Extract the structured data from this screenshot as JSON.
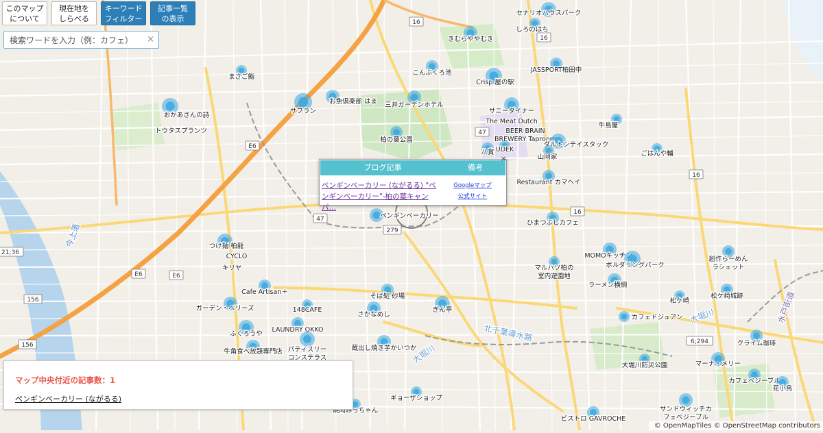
{
  "toolbar": {
    "about": "このマップ\nについて",
    "locate": "現在地を\nしらべる",
    "keyword": "キーワード\nフィルター",
    "list": "記事一覧\nの表示"
  },
  "search": {
    "placeholder": "検索ワードを入力（例：カフェ）",
    "value": "",
    "clear": "×"
  },
  "popup": {
    "col_article": "ブログ記事",
    "col_note": "備考",
    "article_title": "ペンギンベーカリー (ながるる) \"ペンギンベーカリー\"-柏の葉キャンパ…",
    "link_google": "Googleマップ",
    "link_official": "公式サイト",
    "close": "×"
  },
  "panel": {
    "count_text": "マップ中央付近の記事数：1",
    "item": "ペンギンベーカリー (ながるる)"
  },
  "attribution": "© OpenMapTiles © OpenStreetMap contributors",
  "places": [
    {
      "name": "セナリオハウスパーク"
    },
    {
      "name": "しろのはち"
    },
    {
      "name": "きむらややむき"
    },
    {
      "name": "まさご鮨"
    },
    {
      "name": "こんぶくろ池"
    },
    {
      "name": "Crisp 屋の駅"
    },
    {
      "name": "JASSPORT柏田中"
    },
    {
      "name": "お魚倶楽部 はま"
    },
    {
      "name": "三井ガーデンホテル"
    },
    {
      "name": "おかあさんの詩"
    },
    {
      "name": "サフラン"
    },
    {
      "name": "トウタスプランツ"
    },
    {
      "name": "サニーダイナー"
    },
    {
      "name": "The Meat Dutch"
    },
    {
      "name": "BEER BRAIN\nBREWERY Taproom"
    },
    {
      "name": "牛島屋"
    },
    {
      "name": "柏の葉公園"
    },
    {
      "name": "八賞"
    },
    {
      "name": "UDEK"
    },
    {
      "name": "ダルトンテイスタック"
    },
    {
      "name": "ごはんや輔"
    },
    {
      "name": "山岡家"
    },
    {
      "name": "Restaurant カマヘイ"
    },
    {
      "name": "ひまつぶしカフェ"
    },
    {
      "name": "ペンギンベーカリー"
    },
    {
      "name": "つけ麺 柏龍"
    },
    {
      "name": "CYCLO"
    },
    {
      "name": "キリヤ"
    },
    {
      "name": "MOMOキッチン"
    },
    {
      "name": "ボルダリングパーク"
    },
    {
      "name": "創作らーめん\nラシェット"
    },
    {
      "name": "マルハソ柏の\n室内遊園地"
    },
    {
      "name": "ラーメン横綱"
    },
    {
      "name": "Cafe Artisan＋"
    },
    {
      "name": "そば処 砂場"
    },
    {
      "name": "松ケ崎"
    },
    {
      "name": "松ケ崎城跡"
    },
    {
      "name": "ガーデン・ベリーズ"
    },
    {
      "name": "148CAFE"
    },
    {
      "name": "さかなめし"
    },
    {
      "name": "ぎん亭"
    },
    {
      "name": "カフェドジュアン"
    },
    {
      "name": "ふくろうや"
    },
    {
      "name": "LAUNDRY OKKO"
    },
    {
      "name": "パティスリー\nコンステラス"
    },
    {
      "name": "牛角食べ放題専門店"
    },
    {
      "name": "蔵出し焼き芋かいつか"
    },
    {
      "name": "クライム珈琲"
    },
    {
      "name": "大堀川防災公園"
    },
    {
      "name": "マーナ・メリー"
    },
    {
      "name": "カフェベジーブル"
    },
    {
      "name": "花小鳥"
    },
    {
      "name": "ギョーザショップ"
    },
    {
      "name": "焼肉みっちゃん"
    },
    {
      "name": "サンドウィッチカ\nフェベジーブル"
    },
    {
      "name": "ビストロ GAVROCHE"
    }
  ],
  "areas": [
    {
      "name": "今上落"
    },
    {
      "name": "大堀川"
    },
    {
      "name": "北千葉導水路"
    },
    {
      "name": "水戸街道"
    },
    {
      "name": "大堀川"
    }
  ],
  "shields": [
    {
      "label": "16"
    },
    {
      "label": "16"
    },
    {
      "label": "E6"
    },
    {
      "label": "E6"
    },
    {
      "label": "47"
    },
    {
      "label": "47"
    },
    {
      "label": "279"
    },
    {
      "label": "16"
    },
    {
      "label": "16"
    },
    {
      "label": "156"
    },
    {
      "label": "E6"
    },
    {
      "label": "156"
    },
    {
      "label": "6;294"
    },
    {
      "label": "21;36"
    }
  ],
  "colors": {
    "cluster": "#3ea8e0",
    "accent": "#2d7fb8",
    "popup_header": "#55c1cf",
    "count": "#e8574b",
    "major_road": "#f5a243"
  }
}
